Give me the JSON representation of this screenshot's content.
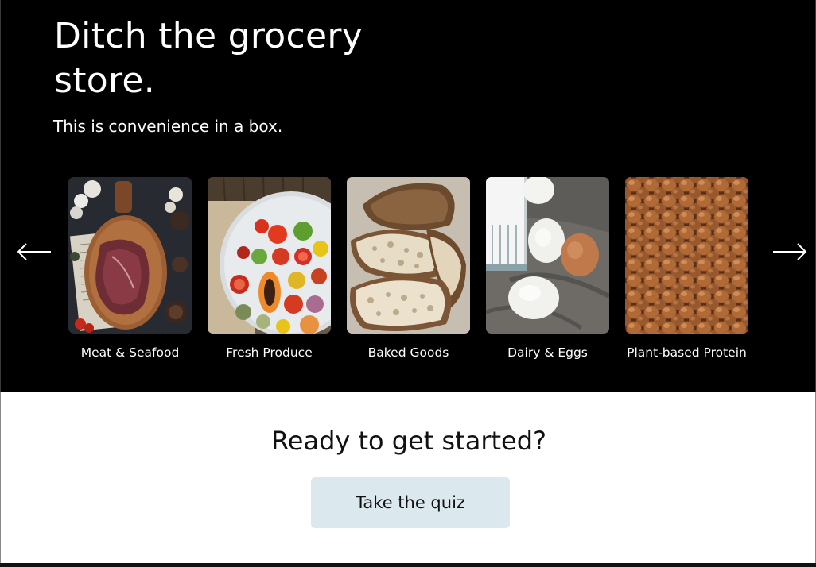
{
  "hero": {
    "headline": "Ditch the grocery store.",
    "subheadline": "This is convenience in a box.",
    "bg_color": "#000000"
  },
  "carousel": {
    "prev_icon": "arrow-left-icon",
    "next_icon": "arrow-right-icon",
    "categories": [
      {
        "label": "Meat & Seafood",
        "image": "raw steak on wooden board"
      },
      {
        "label": "Fresh Produce",
        "image": "platter of tomatoes and papaya"
      },
      {
        "label": "Baked Goods",
        "image": "sliced sourdough bread"
      },
      {
        "label": "Dairy & Eggs",
        "image": "glass of milk and eggs"
      },
      {
        "label": "Plant-based Protein",
        "image": "hazelnuts"
      }
    ]
  },
  "cta": {
    "title": "Ready to get started?",
    "button_label": "Take the quiz",
    "button_color": "#dbe8ee"
  }
}
